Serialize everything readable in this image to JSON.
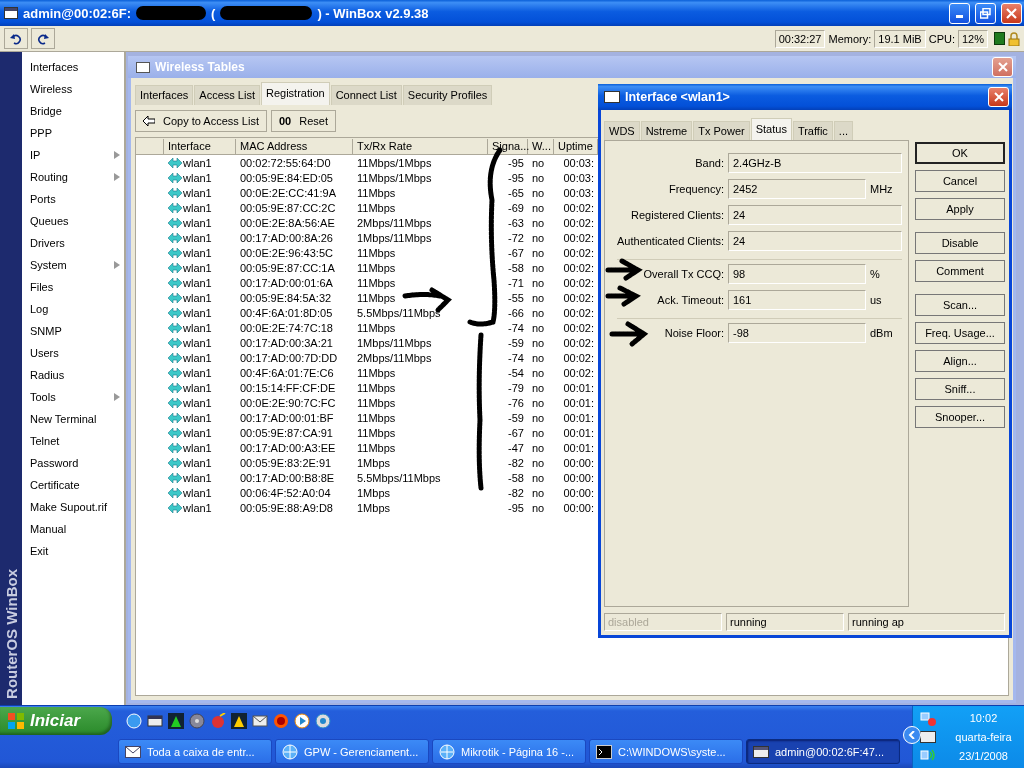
{
  "window": {
    "title_parts": [
      "admin@00:02:6F:",
      "(",
      ") - WinBox v2.9.38"
    ]
  },
  "toolbar": {
    "uptime": "00:32:27",
    "memory_label": "Memory:",
    "memory": "19.1 MiB",
    "cpu_label": "CPU:",
    "cpu": "12%"
  },
  "side_banner": "RouterOS WinBox",
  "sidebar": {
    "items": [
      {
        "label": "Interfaces",
        "submenu": false
      },
      {
        "label": "Wireless",
        "submenu": false
      },
      {
        "label": "Bridge",
        "submenu": false
      },
      {
        "label": "PPP",
        "submenu": false
      },
      {
        "label": "IP",
        "submenu": true
      },
      {
        "label": "Routing",
        "submenu": true
      },
      {
        "label": "Ports",
        "submenu": false
      },
      {
        "label": "Queues",
        "submenu": false
      },
      {
        "label": "Drivers",
        "submenu": false
      },
      {
        "label": "System",
        "submenu": true
      },
      {
        "label": "Files",
        "submenu": false
      },
      {
        "label": "Log",
        "submenu": false
      },
      {
        "label": "SNMP",
        "submenu": false
      },
      {
        "label": "Users",
        "submenu": false
      },
      {
        "label": "Radius",
        "submenu": false
      },
      {
        "label": "Tools",
        "submenu": true
      },
      {
        "label": "New Terminal",
        "submenu": false
      },
      {
        "label": "Telnet",
        "submenu": false
      },
      {
        "label": "Password",
        "submenu": false
      },
      {
        "label": "Certificate",
        "submenu": false
      },
      {
        "label": "Make Supout.rif",
        "submenu": false
      },
      {
        "label": "Manual",
        "submenu": false
      },
      {
        "label": "Exit",
        "submenu": false
      }
    ]
  },
  "wireless_tables": {
    "title": "Wireless Tables",
    "tabs": [
      {
        "label": "Interfaces",
        "selected": false
      },
      {
        "label": "Access List",
        "selected": false
      },
      {
        "label": "Registration",
        "selected": true
      },
      {
        "label": "Connect List",
        "selected": false
      },
      {
        "label": "Security Profiles",
        "selected": false
      }
    ],
    "buttons": [
      {
        "label": "Copy to Access List",
        "kind": "copy"
      },
      {
        "label": "Reset",
        "kind": "reset",
        "icon_text": "00"
      }
    ],
    "columns": [
      "Interface",
      "MAC Address",
      "Tx/Rx Rate",
      "Signa...",
      "W...",
      "Uptime"
    ],
    "rows": [
      [
        "wlan1",
        "00:02:72:55:64:D0",
        "11Mbps/1Mbps",
        "-95",
        "no",
        "00:03:"
      ],
      [
        "wlan1",
        "00:05:9E:84:ED:05",
        "11Mbps/1Mbps",
        "-95",
        "no",
        "00:03:"
      ],
      [
        "wlan1",
        "00:0E:2E:CC:41:9A",
        "11Mbps",
        "-65",
        "no",
        "00:03:"
      ],
      [
        "wlan1",
        "00:05:9E:87:CC:2C",
        "11Mbps",
        "-69",
        "no",
        "00:02:"
      ],
      [
        "wlan1",
        "00:0E:2E:8A:56:AE",
        "2Mbps/11Mbps",
        "-63",
        "no",
        "00:02:"
      ],
      [
        "wlan1",
        "00:17:AD:00:8A:26",
        "1Mbps/11Mbps",
        "-72",
        "no",
        "00:02:"
      ],
      [
        "wlan1",
        "00:0E:2E:96:43:5C",
        "11Mbps",
        "-67",
        "no",
        "00:02:"
      ],
      [
        "wlan1",
        "00:05:9E:87:CC:1A",
        "11Mbps",
        "-58",
        "no",
        "00:02:"
      ],
      [
        "wlan1",
        "00:17:AD:00:01:6A",
        "11Mbps",
        "-71",
        "no",
        "00:02:"
      ],
      [
        "wlan1",
        "00:05:9E:84:5A:32",
        "11Mbps",
        "-55",
        "no",
        "00:02:"
      ],
      [
        "wlan1",
        "00:4F:6A:01:8D:05",
        "5.5Mbps/11Mbps",
        "-66",
        "no",
        "00:02:"
      ],
      [
        "wlan1",
        "00:0E:2E:74:7C:18",
        "11Mbps",
        "-74",
        "no",
        "00:02:"
      ],
      [
        "wlan1",
        "00:17:AD:00:3A:21",
        "1Mbps/11Mbps",
        "-59",
        "no",
        "00:02:"
      ],
      [
        "wlan1",
        "00:17:AD:00:7D:DD",
        "2Mbps/11Mbps",
        "-74",
        "no",
        "00:02:"
      ],
      [
        "wlan1",
        "00:4F:6A:01:7E:C6",
        "11Mbps",
        "-54",
        "no",
        "00:02:"
      ],
      [
        "wlan1",
        "00:15:14:FF:CF:DE",
        "11Mbps",
        "-79",
        "no",
        "00:01:"
      ],
      [
        "wlan1",
        "00:0E:2E:90:7C:FC",
        "11Mbps",
        "-76",
        "no",
        "00:01:"
      ],
      [
        "wlan1",
        "00:17:AD:00:01:BF",
        "11Mbps",
        "-59",
        "no",
        "00:01:"
      ],
      [
        "wlan1",
        "00:05:9E:87:CA:91",
        "11Mbps",
        "-67",
        "no",
        "00:01:"
      ],
      [
        "wlan1",
        "00:17:AD:00:A3:EE",
        "11Mbps",
        "-47",
        "no",
        "00:01:"
      ],
      [
        "wlan1",
        "00:05:9E:83:2E:91",
        "1Mbps",
        "-82",
        "no",
        "00:00:"
      ],
      [
        "wlan1",
        "00:17:AD:00:B8:8E",
        "5.5Mbps/11Mbps",
        "-58",
        "no",
        "00:00:"
      ],
      [
        "wlan1",
        "00:06:4F:52:A0:04",
        "1Mbps",
        "-82",
        "no",
        "00:00:"
      ],
      [
        "wlan1",
        "00:05:9E:88:A9:D8",
        "1Mbps",
        "-95",
        "no",
        "00:00:"
      ]
    ]
  },
  "interface_window": {
    "title": "Interface <wlan1>",
    "tabs": [
      {
        "label": "WDS",
        "selected": false
      },
      {
        "label": "Nstreme",
        "selected": false
      },
      {
        "label": "Tx Power",
        "selected": false
      },
      {
        "label": "Status",
        "selected": true
      },
      {
        "label": "Traffic",
        "selected": false
      },
      {
        "label": "...",
        "selected": false
      }
    ],
    "field_groups": [
      [
        {
          "label": "Band:",
          "value": "2.4GHz-B"
        },
        {
          "label": "Frequency:",
          "value": "2452",
          "unit": "MHz"
        },
        {
          "label": "Registered Clients:",
          "value": "24"
        },
        {
          "label": "Authenticated Clients:",
          "value": "24"
        }
      ],
      [
        {
          "label": "Overall Tx CCQ:",
          "value": "98",
          "unit": "%"
        },
        {
          "label": "Ack. Timeout:",
          "value": "161",
          "unit": "us"
        }
      ],
      [
        {
          "label": "Noise Floor:",
          "value": "-98",
          "unit": "dBm"
        }
      ]
    ],
    "buttons": [
      {
        "label": "OK",
        "kind": "default"
      },
      {
        "label": "Cancel",
        "kind": "normal"
      },
      {
        "label": "Apply",
        "kind": "normal"
      },
      {
        "label": "Disable",
        "kind": "spaced"
      },
      {
        "label": "Comment",
        "kind": "normal"
      },
      {
        "label": "Scan...",
        "kind": "spaced"
      },
      {
        "label": "Freq. Usage...",
        "kind": "normal"
      },
      {
        "label": "Align...",
        "kind": "normal"
      },
      {
        "label": "Sniff...",
        "kind": "normal"
      },
      {
        "label": "Snooper...",
        "kind": "normal"
      }
    ],
    "status": [
      {
        "text": "disabled",
        "active": false
      },
      {
        "text": "running",
        "active": true
      },
      {
        "text": "running ap",
        "active": true
      }
    ]
  },
  "taskbar": {
    "start": "Iniciar",
    "tasks": [
      {
        "label": "Toda a caixa de entr...",
        "kind": "mail",
        "selected": false
      },
      {
        "label": "GPW - Gerenciament...",
        "kind": "browser",
        "selected": false
      },
      {
        "label": "Mikrotik - Página 16 -...",
        "kind": "browser",
        "selected": false
      },
      {
        "label": "C:\\WINDOWS\\syste...",
        "kind": "console",
        "selected": false
      },
      {
        "label": "admin@00:02:6F:47...",
        "kind": "winbox",
        "selected": true
      }
    ],
    "clock": {
      "time": "10:02",
      "day": "quarta-feira",
      "date": "23/1/2008"
    }
  }
}
